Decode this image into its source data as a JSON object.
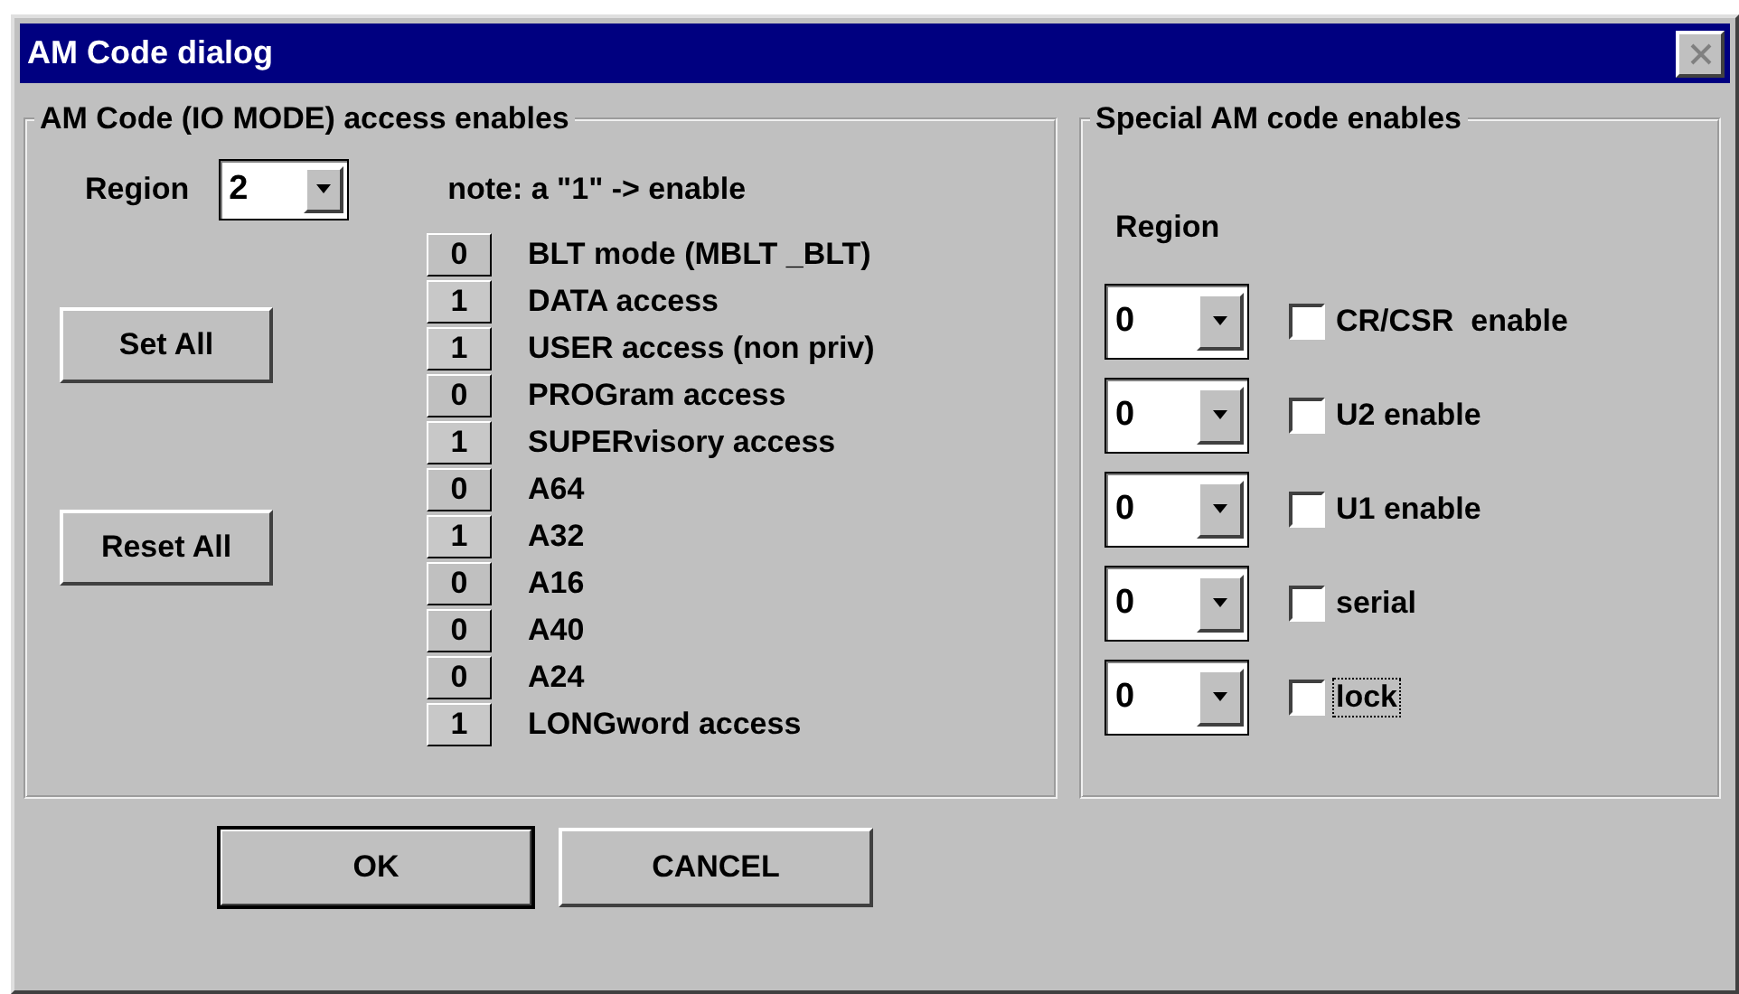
{
  "window": {
    "title": "AM Code dialog"
  },
  "access_group": {
    "title": "AM Code (IO MODE) access enables",
    "region_label": "Region",
    "region_value": "2",
    "note": "note: a \"1\" -> enable",
    "buttons": [
      "Set All",
      "Reset All"
    ],
    "bits": [
      {
        "value": "0",
        "label": "BLT mode (MBLT _BLT)"
      },
      {
        "value": "1",
        "label": "DATA access"
      },
      {
        "value": "1",
        "label": "USER access (non priv)"
      },
      {
        "value": "0",
        "label": "PROGram access"
      },
      {
        "value": "1",
        "label": "SUPERvisory access"
      },
      {
        "value": "0",
        "label": "A64"
      },
      {
        "value": "1",
        "label": "A32"
      },
      {
        "value": "0",
        "label": "A16"
      },
      {
        "value": "0",
        "label": "A40"
      },
      {
        "value": "0",
        "label": "A24"
      },
      {
        "value": "1",
        "label": "LONGword access"
      }
    ]
  },
  "special_group": {
    "title": "Special AM code enables",
    "region_label": "Region",
    "rows": [
      {
        "region": "0",
        "label": "CR/CSR  enable",
        "checked": false,
        "focused": false
      },
      {
        "region": "0",
        "label": "U2 enable",
        "checked": false,
        "focused": false
      },
      {
        "region": "0",
        "label": "U1 enable",
        "checked": false,
        "focused": false
      },
      {
        "region": "0",
        "label": "serial",
        "checked": false,
        "focused": false
      },
      {
        "region": "0",
        "label": "lock",
        "checked": false,
        "focused": true
      }
    ]
  },
  "buttons": [
    {
      "label": "OK",
      "default": true
    },
    {
      "label": "CANCEL",
      "default": false
    }
  ]
}
